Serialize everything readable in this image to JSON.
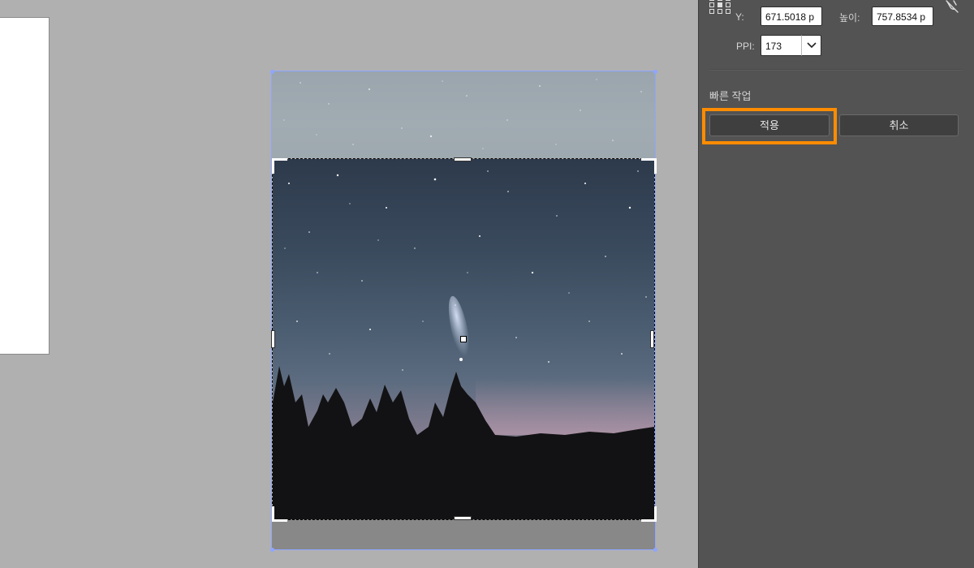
{
  "transform": {
    "y_label": "Y:",
    "y_value": "671.5018 p",
    "height_label": "높이:",
    "height_value": "757.8534 p",
    "ppi_label": "PPI:",
    "ppi_value": "173"
  },
  "quick_actions": {
    "title": "빠른 작업",
    "apply_label": "적용",
    "cancel_label": "취소"
  },
  "icons": {
    "reference_point": "reference-point-grid-icon",
    "link": "unlink-chain-icon",
    "dropdown": "chevron-down-icon"
  },
  "colors": {
    "highlight": "#ff8c00",
    "panel_bg": "#535353",
    "canvas_bg": "#b0b0b0",
    "frame_outline": "#8ea6ff"
  }
}
